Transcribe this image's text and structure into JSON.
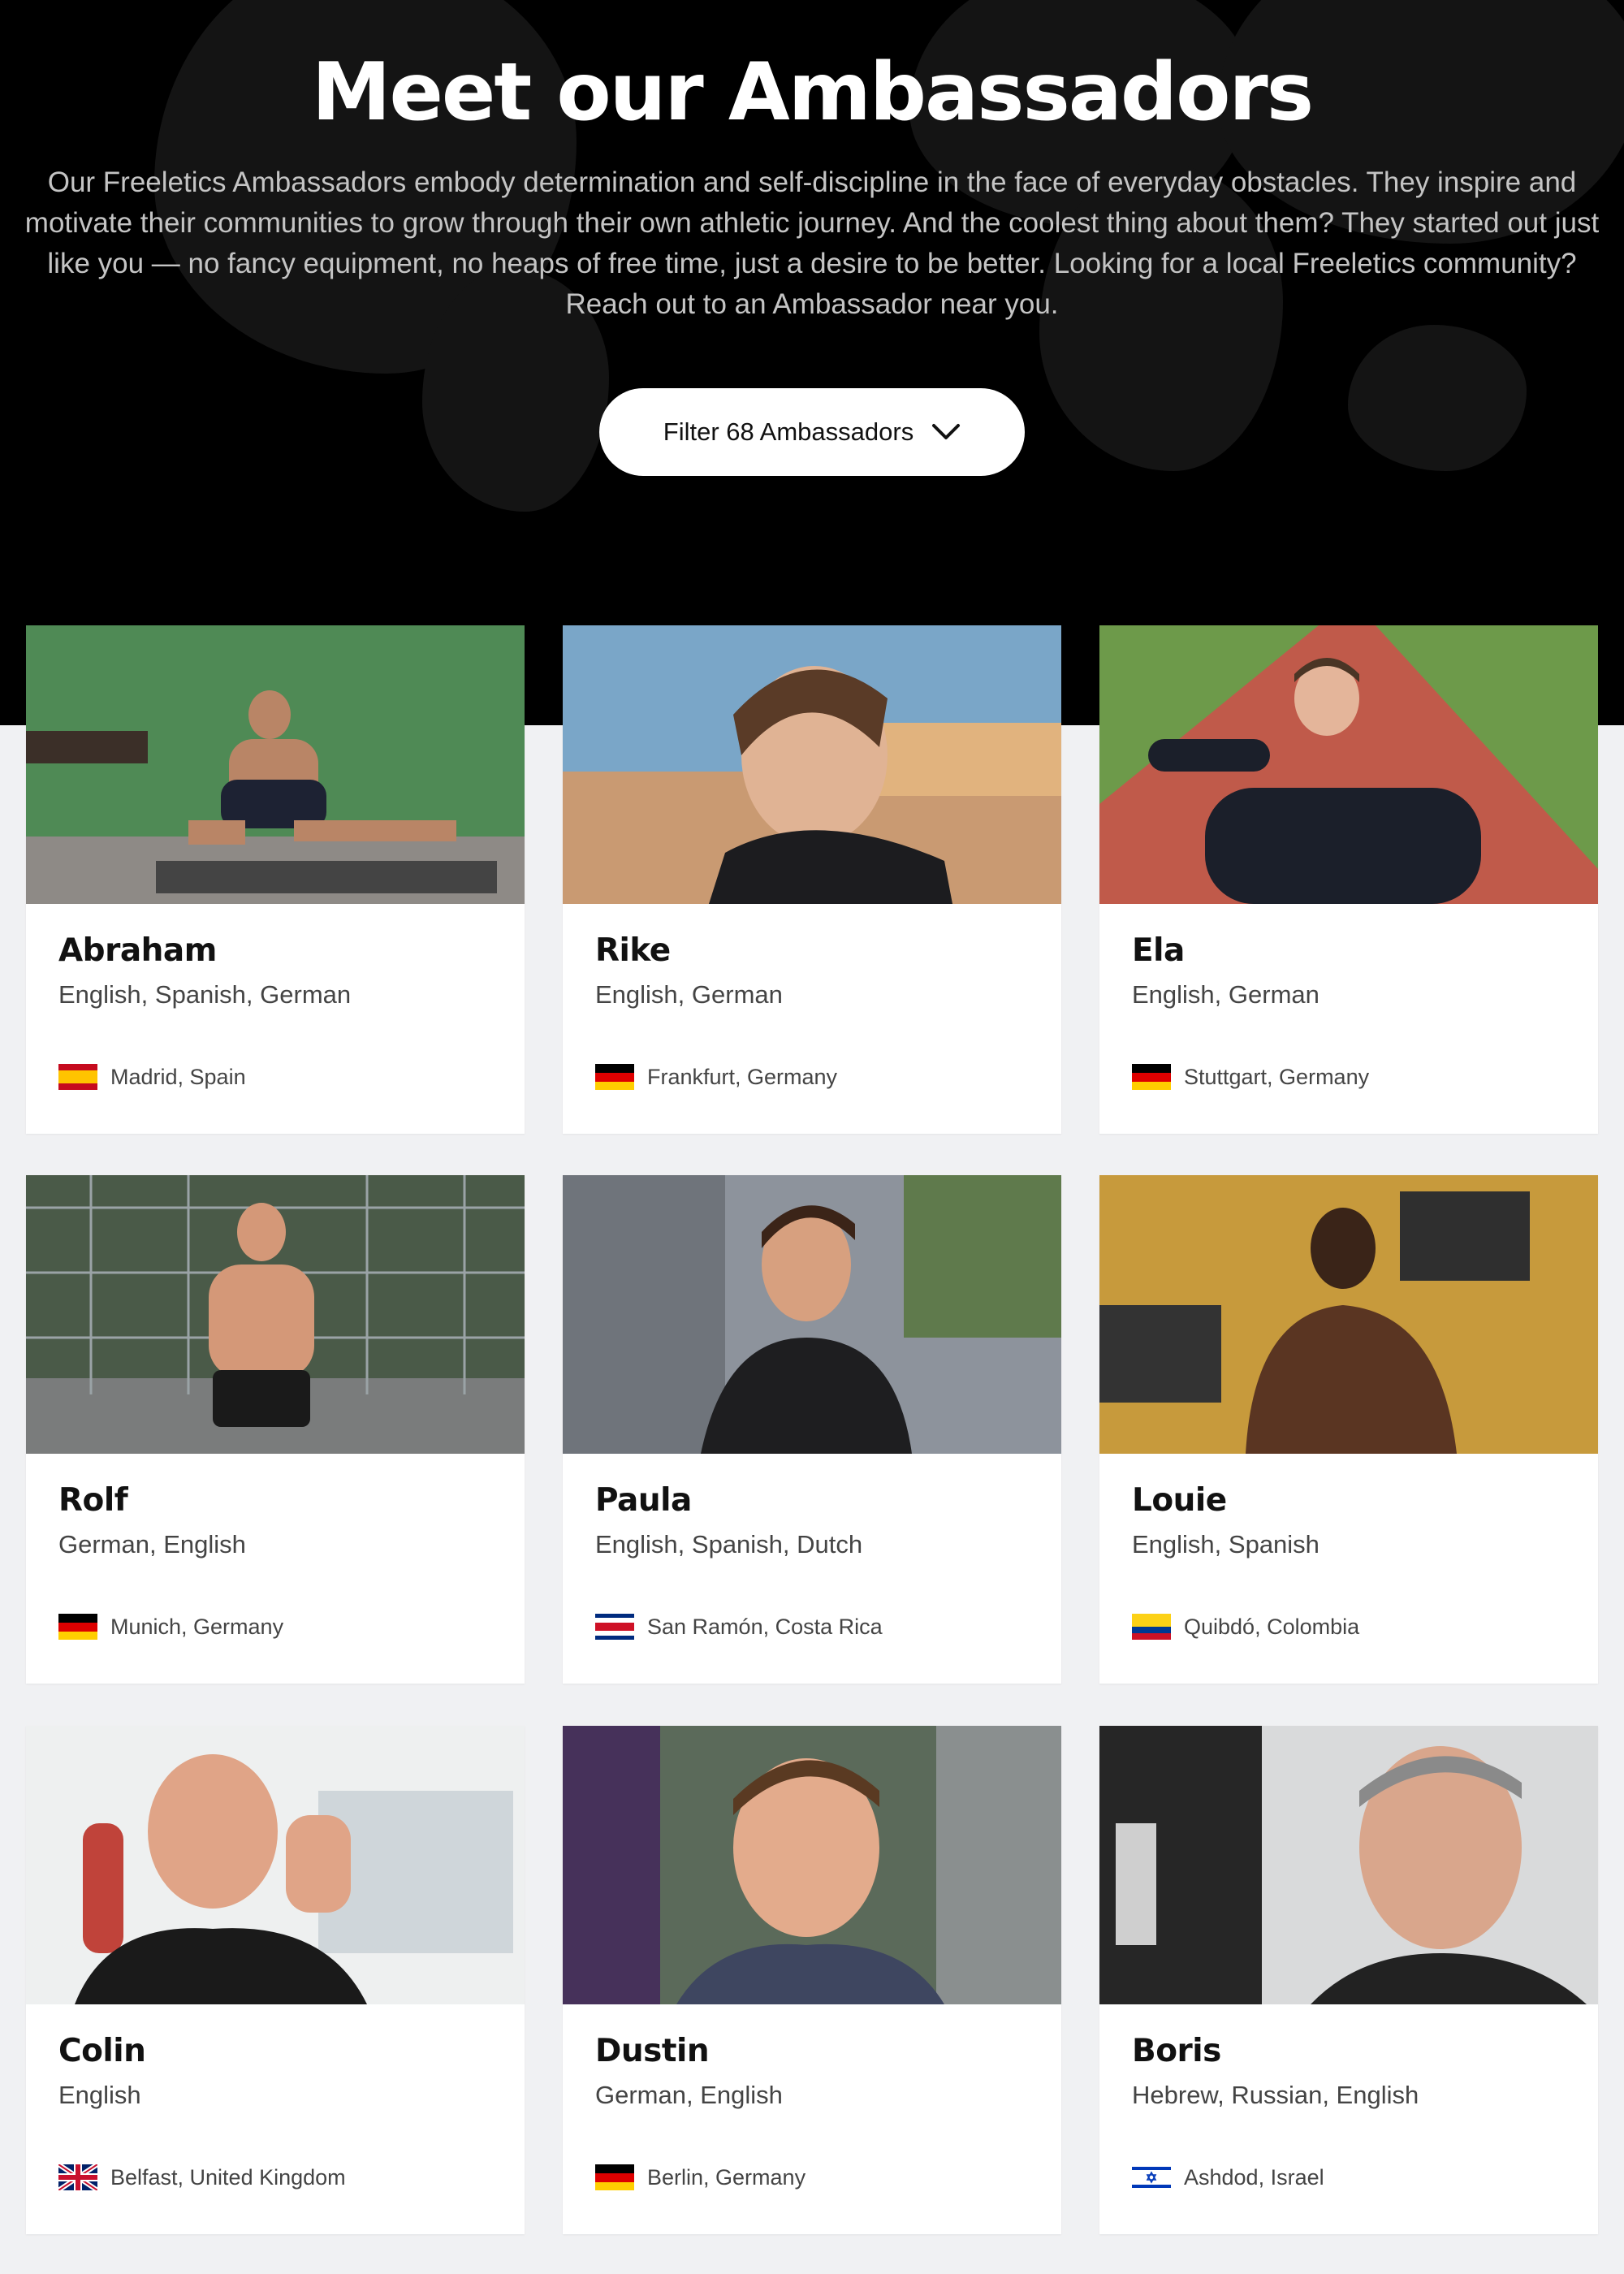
{
  "hero": {
    "title": "Meet our Ambassadors",
    "description": "Our Freeletics Ambassadors embody determination and self-discipline in the face of everyday obstacles. They inspire and motivate their communities to grow through their own athletic journey. And the coolest thing about them? They started out just like you — no fancy equipment, no heaps of free time, just a desire to be better. Looking for a local Freeletics community? Reach out to an Ambassador near you.",
    "filter_label": "Filter 68 Ambassadors",
    "filter_icon": "chevron-down-icon"
  },
  "colors": {
    "hero_bg": "#000000",
    "page_bg": "#f0f1f3",
    "card_bg": "#ffffff",
    "text_primary": "#111111",
    "text_secondary": "#444444"
  },
  "ambassadors": [
    {
      "name": "Abraham",
      "languages": "English, Spanish, German",
      "location": "Madrid, Spain",
      "flag": "spain-flag-icon"
    },
    {
      "name": "Rike",
      "languages": "English, German",
      "location": "Frankfurt, Germany",
      "flag": "germany-flag-icon"
    },
    {
      "name": "Ela",
      "languages": "English, German",
      "location": "Stuttgart, Germany",
      "flag": "germany-flag-icon"
    },
    {
      "name": "Rolf",
      "languages": "German, English",
      "location": "Munich, Germany",
      "flag": "germany-flag-icon"
    },
    {
      "name": "Paula",
      "languages": "English, Spanish, Dutch",
      "location": "San Ramón, Costa Rica",
      "flag": "costa-rica-flag-icon"
    },
    {
      "name": "Louie",
      "languages": "English, Spanish",
      "location": "Quibdó, Colombia",
      "flag": "colombia-flag-icon"
    },
    {
      "name": "Colin",
      "languages": "English",
      "location": "Belfast, United Kingdom",
      "flag": "uk-flag-icon"
    },
    {
      "name": "Dustin",
      "languages": "German, English",
      "location": "Berlin, Germany",
      "flag": "germany-flag-icon"
    },
    {
      "name": "Boris",
      "languages": "Hebrew, Russian, English",
      "location": "Ashdod, Israel",
      "flag": "israel-flag-icon"
    }
  ]
}
